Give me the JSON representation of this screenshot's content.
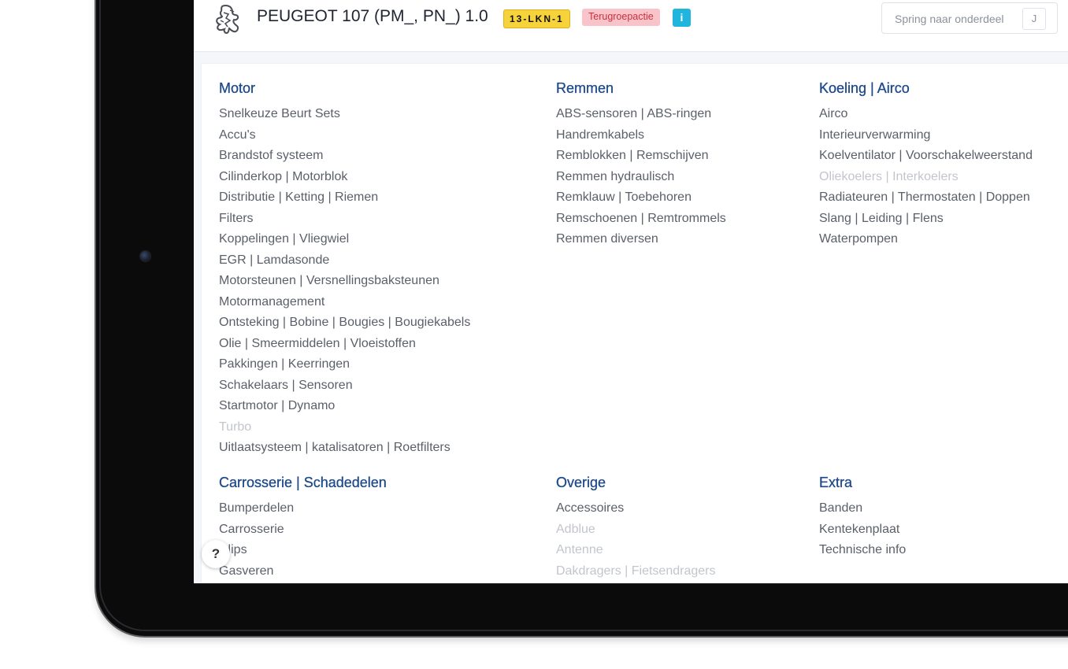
{
  "header": {
    "car_title": "PEUGEOT 107 (PM_, PN_) 1.0",
    "plate": "13-LKN-1",
    "recall_badge": "Terugroepactie",
    "info_label": "i",
    "jump_placeholder": "Spring naar onderdeel",
    "jump_shortcut": "J"
  },
  "help_label": "?",
  "categories": [
    {
      "title": "Motor",
      "items": [
        {
          "label": "Snelkeuze Beurt Sets",
          "enabled": true
        },
        {
          "label": "Accu's",
          "enabled": true
        },
        {
          "label": "Brandstof systeem",
          "enabled": true
        },
        {
          "label": "Cilinderkop | Motorblok",
          "enabled": true
        },
        {
          "label": "Distributie | Ketting | Riemen",
          "enabled": true
        },
        {
          "label": "Filters",
          "enabled": true
        },
        {
          "label": "Koppelingen | Vliegwiel",
          "enabled": true
        },
        {
          "label": "EGR | Lamdasonde",
          "enabled": true
        },
        {
          "label": "Motorsteunen | Versnellingsbaksteunen",
          "enabled": true
        },
        {
          "label": "Motormanagement",
          "enabled": true
        },
        {
          "label": "Ontsteking | Bobine | Bougies | Bougiekabels",
          "enabled": true
        },
        {
          "label": "Olie | Smeermiddelen | Vloeistoffen",
          "enabled": true
        },
        {
          "label": "Pakkingen | Keerringen",
          "enabled": true
        },
        {
          "label": "Schakelaars | Sensoren",
          "enabled": true
        },
        {
          "label": "Startmotor | Dynamo",
          "enabled": true
        },
        {
          "label": "Turbo",
          "enabled": false
        },
        {
          "label": "Uitlaatsysteem | katalisatoren | Roetfilters",
          "enabled": true
        }
      ]
    },
    {
      "title": "Remmen",
      "items": [
        {
          "label": "ABS-sensoren | ABS-ringen",
          "enabled": true
        },
        {
          "label": "Handremkabels",
          "enabled": true
        },
        {
          "label": "Remblokken | Remschijven",
          "enabled": true
        },
        {
          "label": "Remmen hydraulisch",
          "enabled": true
        },
        {
          "label": "Remklauw | Toebehoren",
          "enabled": true
        },
        {
          "label": "Remschoenen | Remtrommels",
          "enabled": true
        },
        {
          "label": "Remmen diversen",
          "enabled": true
        }
      ]
    },
    {
      "title": "Koeling | Airco",
      "items": [
        {
          "label": "Airco",
          "enabled": true
        },
        {
          "label": "Interieurverwarming",
          "enabled": true
        },
        {
          "label": "Koelventilator | Voorschakelweerstand",
          "enabled": true
        },
        {
          "label": "Oliekoelers | Interkoelers",
          "enabled": false
        },
        {
          "label": "Radiateuren | Thermostaten | Doppen",
          "enabled": true
        },
        {
          "label": "Slang | Leiding | Flens",
          "enabled": true
        },
        {
          "label": "Waterpompen",
          "enabled": true
        }
      ]
    },
    {
      "title": "Carrosserie | Schadedelen",
      "items": [
        {
          "label": "Bumperdelen",
          "enabled": true
        },
        {
          "label": "Carrosserie",
          "enabled": true
        },
        {
          "label": "Clips",
          "enabled": true
        },
        {
          "label": "Gasveren",
          "enabled": true
        }
      ]
    },
    {
      "title": "Overige",
      "items": [
        {
          "label": "Accessoires",
          "enabled": true
        },
        {
          "label": "Adblue",
          "enabled": false
        },
        {
          "label": "Antenne",
          "enabled": false
        },
        {
          "label": "Dakdragers | Fietsendragers",
          "enabled": false
        }
      ]
    },
    {
      "title": "Extra",
      "items": [
        {
          "label": "Banden",
          "enabled": true
        },
        {
          "label": "Kentekenplaat",
          "enabled": true
        },
        {
          "label": "Technische info",
          "enabled": true
        }
      ]
    }
  ]
}
